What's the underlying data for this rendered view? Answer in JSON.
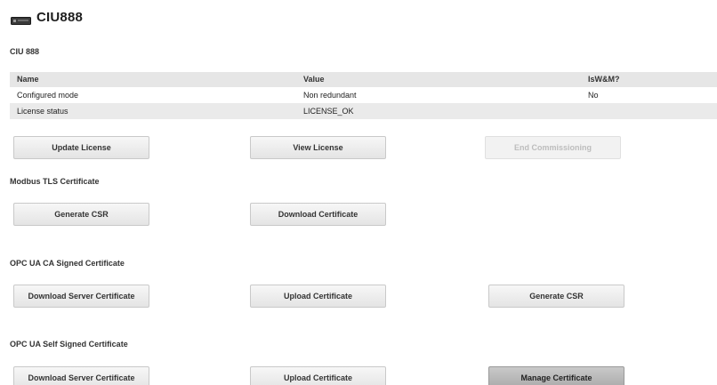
{
  "header": {
    "title": "CIU888",
    "icon": "device-icon"
  },
  "device_section": {
    "title": "CIU 888",
    "table": {
      "columns": [
        "Name",
        "Value",
        "IsW&M?"
      ],
      "rows": [
        [
          "Configured mode",
          "Non redundant",
          "No"
        ],
        [
          "License status",
          "LICENSE_OK",
          ""
        ]
      ]
    },
    "buttons": {
      "update_license": "Update License",
      "view_license": "View License",
      "end_commissioning": "End Commissioning"
    }
  },
  "modbus_section": {
    "title": "Modbus TLS Certificate",
    "buttons": {
      "generate_csr": "Generate CSR",
      "download_certificate": "Download Certificate"
    }
  },
  "opc_ca_section": {
    "title": "OPC UA CA Signed Certificate",
    "buttons": {
      "download_server_certificate": "Download Server Certificate",
      "upload_certificate": "Upload Certificate",
      "generate_csr": "Generate CSR"
    }
  },
  "opc_self_section": {
    "title": "OPC UA Self Signed Certificate",
    "buttons": {
      "download_server_certificate": "Download Server Certificate",
      "upload_certificate": "Upload Certificate",
      "manage_certificate": "Manage Certificate"
    }
  }
}
